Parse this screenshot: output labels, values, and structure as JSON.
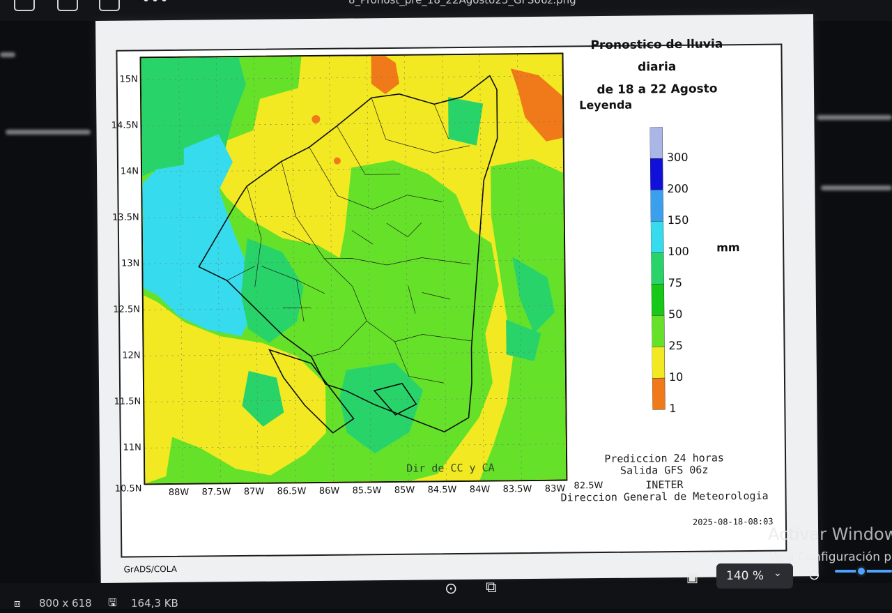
{
  "viewer": {
    "filename": "8_Pronost_pre_18_22Agosto25_GFS06z.png",
    "zoom": "140 %",
    "dimensions": "800 x 618",
    "filesize": "164,3 KB",
    "windows_activation": "Activar Windows",
    "windows_activation_sub": "Ve a Configuración pa"
  },
  "map": {
    "title_line1": "Pronostico de lluvia diaria",
    "title_line2": "de 18 a 22 Agosto",
    "lat_labels": [
      "15N",
      "14.5N",
      "14N",
      "13.5N",
      "13N",
      "12.5N",
      "12N",
      "11.5N",
      "11N",
      "10.5N"
    ],
    "lon_labels": [
      "88W",
      "87.5W",
      "87W",
      "86.5W",
      "86W",
      "85.5W",
      "85W",
      "84.5W",
      "84W",
      "83.5W",
      "83W",
      "82.5W"
    ],
    "legend": {
      "title": "Leyenda",
      "unit": "mm",
      "levels": [
        "300",
        "200",
        "150",
        "100",
        "75",
        "50",
        "25",
        "10",
        "1"
      ],
      "colors": [
        "#a9b6e6",
        "#1010d8",
        "#3aa0ee",
        "#36dcee",
        "#28d46a",
        "#18c818",
        "#66e12a",
        "#f2e923",
        "#f07a1a"
      ]
    },
    "source_label": "Dir de CC y CA",
    "info_line1": "Prediccion 24 horas",
    "info_line2": "Salida GFS 06z",
    "info_line3": "INETER",
    "info_line4": "Direccion General de Meteorologia",
    "timestamp": "2025-08-18-08:03",
    "footer": "GrADS/COLA"
  },
  "colors": {
    "yellow": "#f2e923",
    "light_green": "#66e12a",
    "green": "#18c818",
    "cyan": "#36dcee",
    "orange": "#f07a1a"
  }
}
